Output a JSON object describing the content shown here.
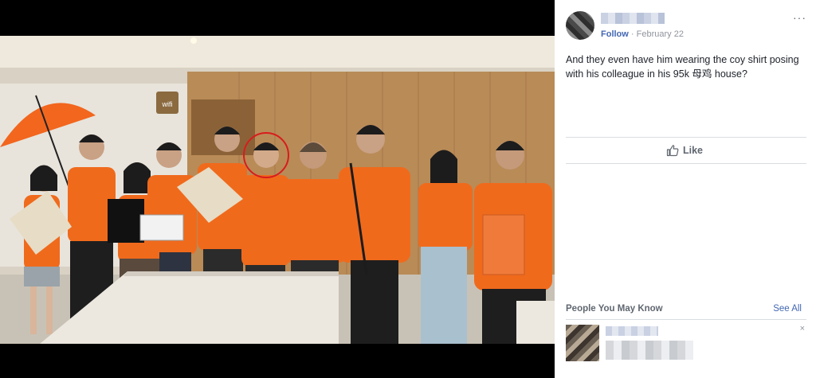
{
  "photo": {
    "wifi_sign": "wifi",
    "colors": {
      "shirt": "#f06a1c",
      "highlight_circle": "#d81c1c",
      "umbrella": "#f2661e"
    }
  },
  "post": {
    "author_name": "",
    "follow_label": "Follow",
    "separator": "·",
    "date": "February 22",
    "more_icon": "···",
    "text": "And they even have him wearing the coy shirt posing with his colleague in his 95k 母鸡 house?",
    "like_label": "Like"
  },
  "pymk": {
    "title": "People You May Know",
    "see_all_label": "See All",
    "close_label": "×"
  },
  "colors": {
    "link": "#4267b2",
    "meta": "#90949c"
  }
}
